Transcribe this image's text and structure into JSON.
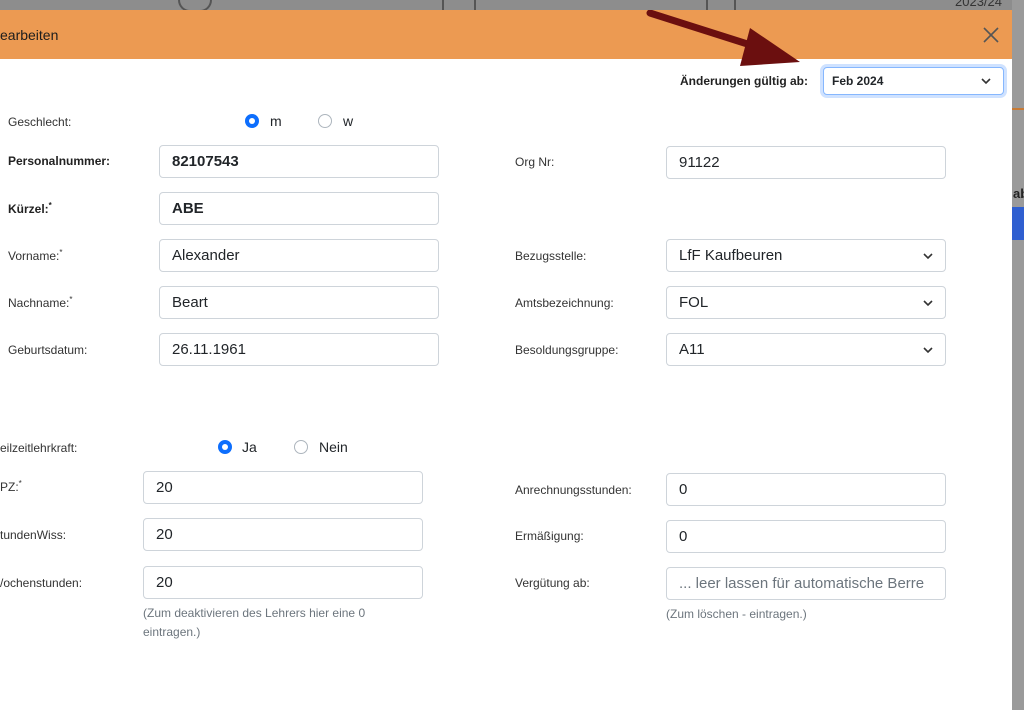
{
  "background": {
    "year": "2023/24",
    "side_label": "ab"
  },
  "header": {
    "title": "earbeiten",
    "color": "#ec9a52"
  },
  "valid_from": {
    "label": "Änderungen gültig ab:",
    "value": "Feb 2024"
  },
  "annotation": {
    "arrow_color": "#6b0f0f"
  },
  "gender": {
    "label": "Geschlecht:",
    "options": [
      "m",
      "w"
    ],
    "selected": "m"
  },
  "personalnummer": {
    "label": "Personalnummer:",
    "value": "82107543"
  },
  "kuerzel": {
    "label": "Kürzel:",
    "required": "*",
    "value": "ABE"
  },
  "vorname": {
    "label": "Vorname:",
    "required": "*",
    "value": "Alexander"
  },
  "nachname": {
    "label": "Nachname:",
    "required": "*",
    "value": "Beart"
  },
  "geburtsdatum": {
    "label": "Geburtsdatum:",
    "value": "26.11.1961"
  },
  "org_nr": {
    "label": "Org Nr:",
    "value": "91122"
  },
  "bezugsstelle": {
    "label": "Bezugsstelle:",
    "value": "LfF Kaufbeuren"
  },
  "amtsbezeichnung": {
    "label": "Amtsbezeichnung:",
    "value": "FOL"
  },
  "besoldungsgruppe": {
    "label": "Besoldungsgruppe:",
    "value": "A11"
  },
  "teilzeit": {
    "label": "eilzeitlehrkraft:",
    "options": [
      "Ja",
      "Nein"
    ],
    "selected": "Ja"
  },
  "upz": {
    "label": "PZ:",
    "required": "*",
    "value": "20"
  },
  "stunden_wiss": {
    "label": "tundenWiss:",
    "value": "20"
  },
  "wochenstunden": {
    "label": "/ochenstunden:",
    "value": "20",
    "help": "(Zum deaktivieren des Lehrers hier eine 0 eintragen.)"
  },
  "anrechnungsstunden": {
    "label": "Anrechnungsstunden:",
    "value": "0"
  },
  "ermaessigung": {
    "label": "Ermäßigung:",
    "value": "0"
  },
  "verguetung": {
    "label": "Vergütung ab:",
    "placeholder": "... leer lassen für automatische Berre",
    "help": "(Zum löschen - eintragen.)"
  }
}
